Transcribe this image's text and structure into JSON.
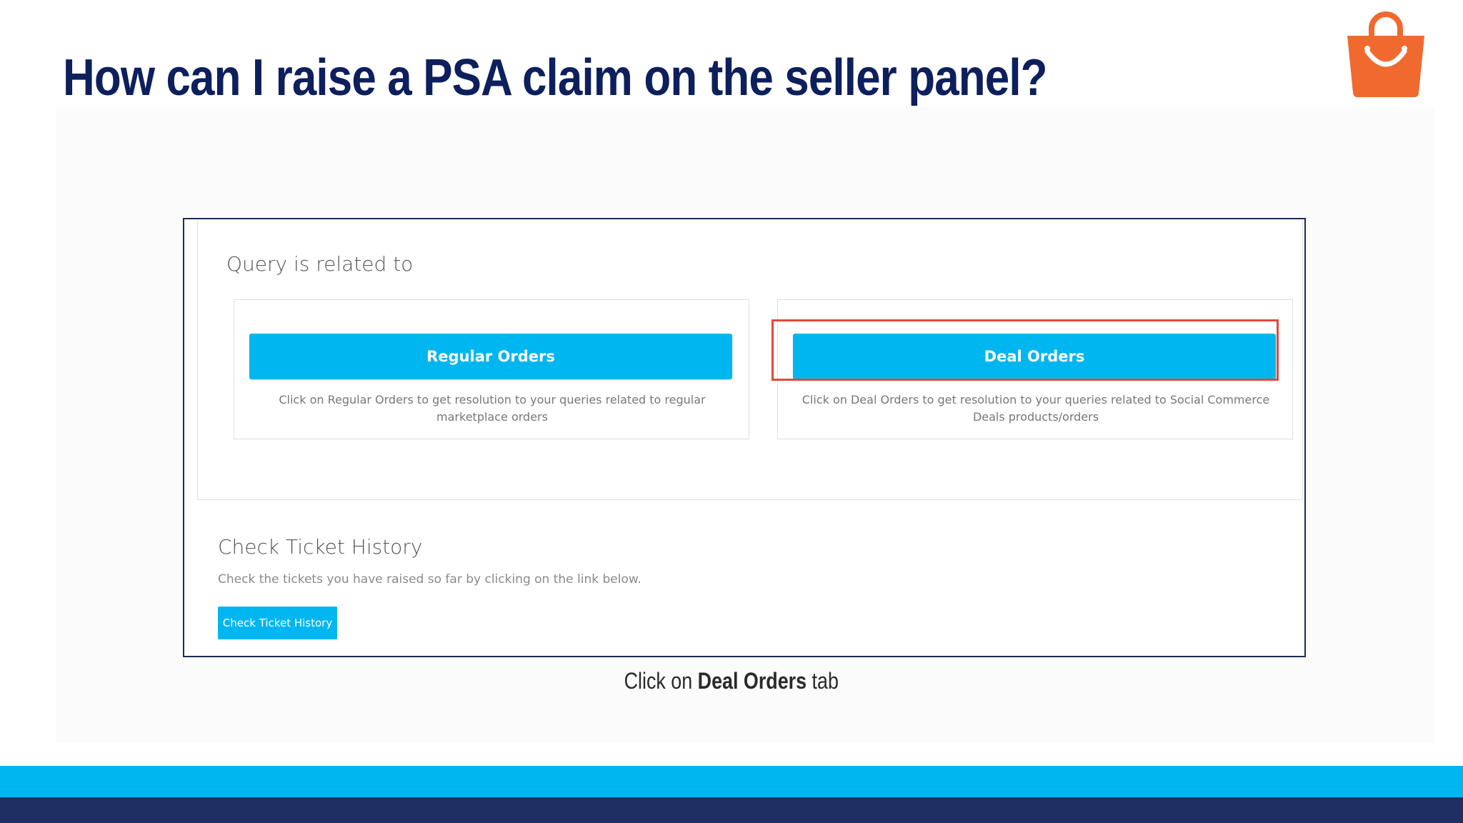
{
  "title": "How can I raise a PSA claim on the seller panel?",
  "logo": {
    "icon": "shopping-bag-icon",
    "color": "#f06a30"
  },
  "screenshot": {
    "query_label": "Query is related to",
    "cards": [
      {
        "button_label": "Regular Orders",
        "description": "Click on Regular Orders to get resolution to your queries related to regular marketplace orders"
      },
      {
        "button_label": "Deal Orders",
        "description": "Click on Deal Orders to get resolution to your queries related to Social Commerce Deals products/orders",
        "highlighted": true
      }
    ],
    "history": {
      "title": "Check Ticket History",
      "description": "Check the tickets you have raised so far by clicking on the link below.",
      "button_label": "Check Ticket History"
    }
  },
  "caption": {
    "prefix": "Click on",
    "bold": "Deal Orders",
    "suffix": "tab"
  },
  "colors": {
    "title": "#0d1f5c",
    "button": "#00b6f0",
    "highlight": "#e04a3c",
    "band_light": "#00b6f0",
    "band_dark": "#1f2f63"
  }
}
